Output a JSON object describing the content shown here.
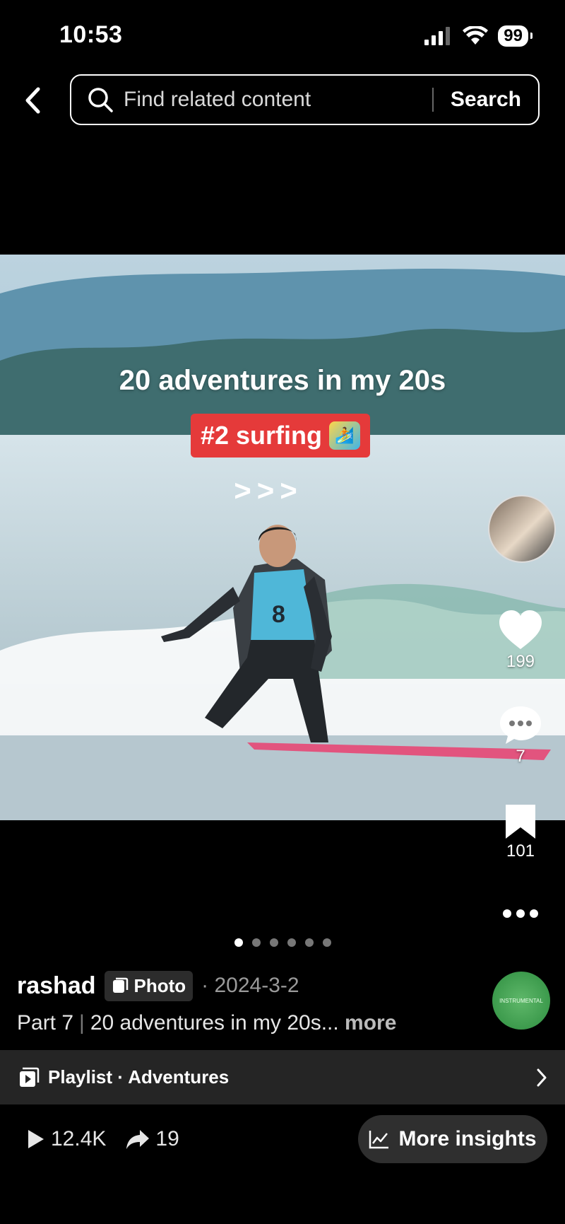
{
  "status_bar": {
    "time": "10:53",
    "battery": "99"
  },
  "search": {
    "placeholder": "Find related content",
    "button_label": "Search"
  },
  "post": {
    "overlay_title": "20 adventures in my 20s",
    "tag_text": "#2 surfing",
    "arrows_text": ">>>",
    "current_slide": 1,
    "slide_count": 6
  },
  "actions": {
    "likes": "199",
    "comments": "7",
    "saves": "101"
  },
  "author": {
    "name": "rashad",
    "badge": "Photo",
    "date": "· 2024-3-2"
  },
  "music": {
    "disc_label": "INSTRUMENTAL"
  },
  "caption": {
    "part": "Part 7",
    "text": "20 adventures in my 20s...",
    "more": "more"
  },
  "playlist": {
    "label": "Playlist · Adventures"
  },
  "stats": {
    "views": "12.4K",
    "shares": "19"
  },
  "insights": {
    "label": "More insights"
  },
  "colors": {
    "tag_red": "#e53a3a",
    "bar_gray": "#252525",
    "insights_gray": "#2f2f2f"
  }
}
